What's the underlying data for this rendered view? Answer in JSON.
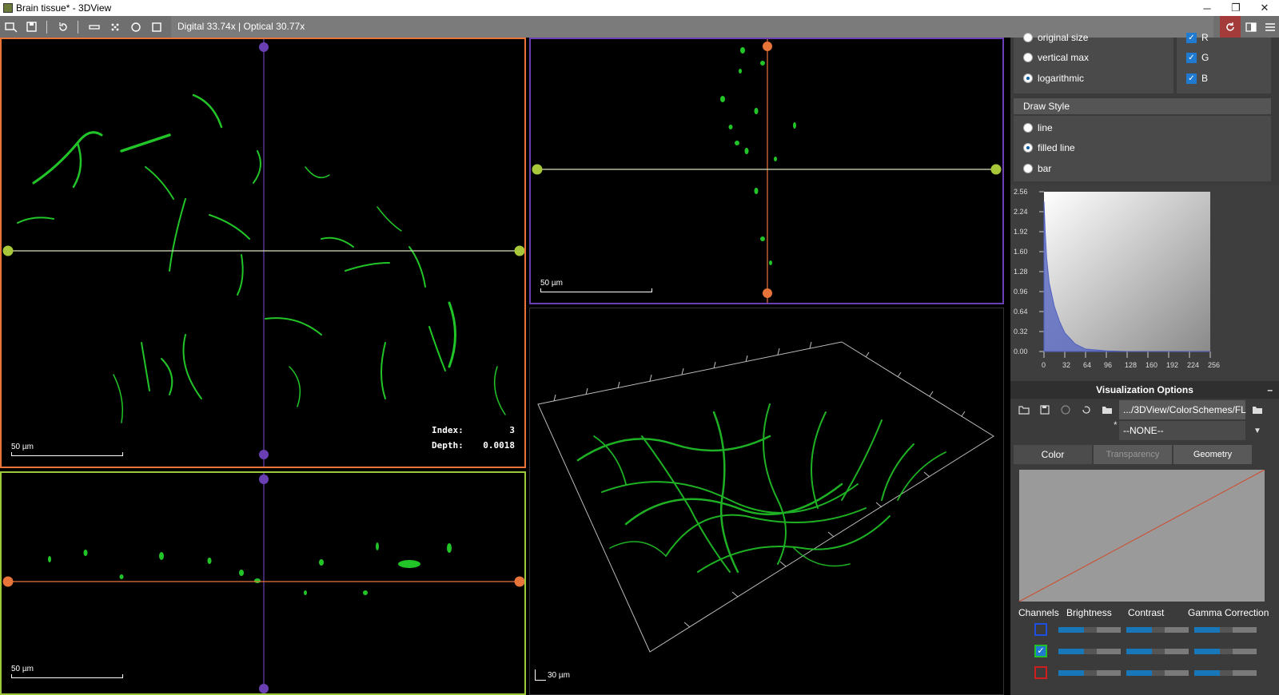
{
  "window": {
    "title": "Brain tissue* - 3DView",
    "minimize": "─",
    "restore": "❐",
    "close": "✕"
  },
  "toolbar": {
    "zoom_text": "Digital 33.74x | Optical 30.77x",
    "buttons": [
      "select-icon",
      "save-icon",
      "reset-icon",
      "ruler-icon",
      "points-icon",
      "circle-icon",
      "square-icon"
    ],
    "right_buttons": [
      "refresh-icon",
      "layout-icon",
      "menu-icon"
    ]
  },
  "viewports": {
    "xy": {
      "scale_label": "50 µm",
      "index_label": "Index:",
      "index_value": "3",
      "depth_label": "Depth:",
      "depth_value": "0.0018"
    },
    "yz": {
      "scale_label": "50 µm"
    },
    "xz": {
      "scale_label": "50 µm"
    },
    "volume": {
      "scale_label": "30 µm"
    }
  },
  "histogram_options": {
    "scale_options": [
      "original size",
      "vertical max",
      "logarithmic"
    ],
    "scale_selected": "logarithmic",
    "channels": [
      "R",
      "G",
      "B"
    ],
    "draw_style_title": "Draw Style",
    "draw_styles": [
      "line",
      "filled line",
      "bar"
    ],
    "draw_style_selected": "filled line"
  },
  "chart_data": {
    "type": "area",
    "y_ticks": [
      "2.56",
      "2.24",
      "1.92",
      "1.60",
      "1.28",
      "0.96",
      "0.64",
      "0.32",
      "0.00"
    ],
    "x_ticks": [
      "0",
      "32",
      "64",
      "96",
      "128",
      "160",
      "192",
      "224",
      "256"
    ],
    "ylim": [
      0,
      2.56
    ],
    "xlim": [
      0,
      256
    ],
    "series": [
      {
        "color": "#5060c0",
        "x": [
          0,
          2,
          4,
          8,
          16,
          24,
          32,
          48,
          64,
          96,
          128,
          256
        ],
        "values": [
          2.4,
          1.9,
          1.5,
          1.1,
          0.72,
          0.48,
          0.3,
          0.12,
          0.04,
          0.01,
          0.0,
          0.0
        ]
      }
    ]
  },
  "visualization": {
    "title": "Visualization Options",
    "collapse": "–",
    "path": ".../3DView/ColorSchemes/FL",
    "preset": "--NONE--",
    "preset_marker": "*",
    "tabs": [
      "Color",
      "Transparency",
      "Geometry"
    ],
    "active_tab": "Color",
    "columns": [
      "Channels",
      "Brightness",
      "Contrast",
      "Gamma Correction"
    ],
    "channel_colors": [
      "#1e4fe0",
      "#22c028",
      "#d01e1e"
    ]
  }
}
